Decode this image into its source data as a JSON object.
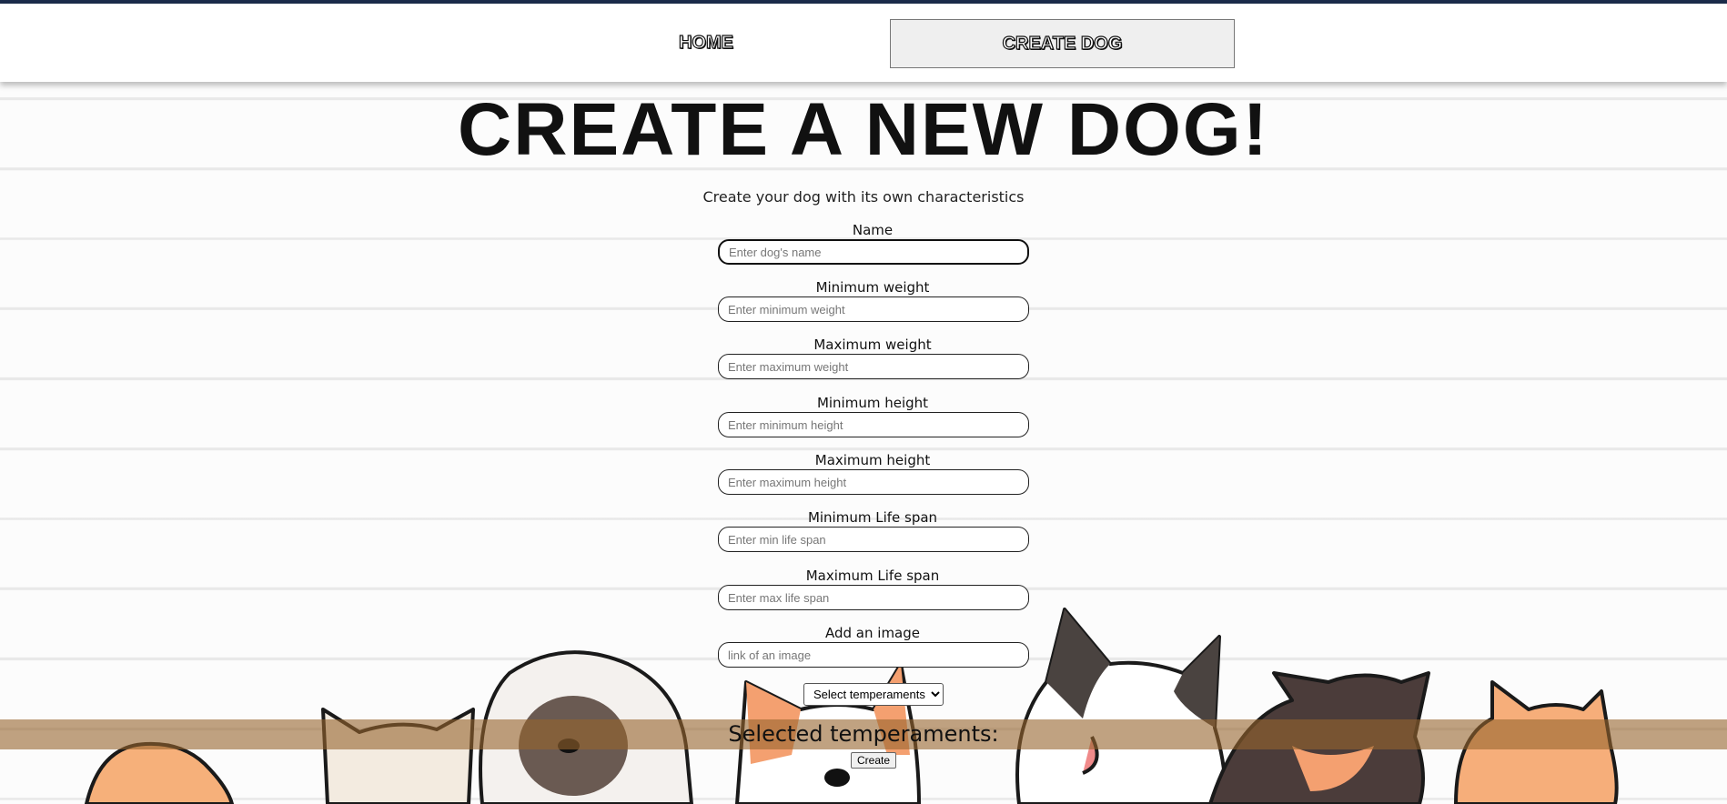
{
  "nav": {
    "home_label": "HOME",
    "create_label": "CREATE DOG"
  },
  "page": {
    "title": "CREATE A NEW DOG!",
    "subtitle": "Create your dog with its own characteristics"
  },
  "form": {
    "fields": [
      {
        "label": "Name",
        "placeholder": "Enter dog's name"
      },
      {
        "label": "Minimum weight",
        "placeholder": "Enter minimum weight"
      },
      {
        "label": "Maximum weight",
        "placeholder": "Enter maximum weight"
      },
      {
        "label": "Minimum height",
        "placeholder": "Enter minimum height"
      },
      {
        "label": "Maximum height",
        "placeholder": "Enter maximum height"
      },
      {
        "label": "Minimum Life span",
        "placeholder": "Enter min life span"
      },
      {
        "label": "Maximum Life span",
        "placeholder": "Enter max life span"
      },
      {
        "label": "Add an image",
        "placeholder": "link of an image"
      }
    ],
    "temperaments_select": "Select temperaments",
    "selected_label": "Selected temperaments:",
    "create_label": "Create"
  },
  "colors": {
    "accent_bar": "#1b2c4a",
    "band": "#96642d"
  },
  "icons": {
    "select_chevron": "chevron-down-icon"
  }
}
